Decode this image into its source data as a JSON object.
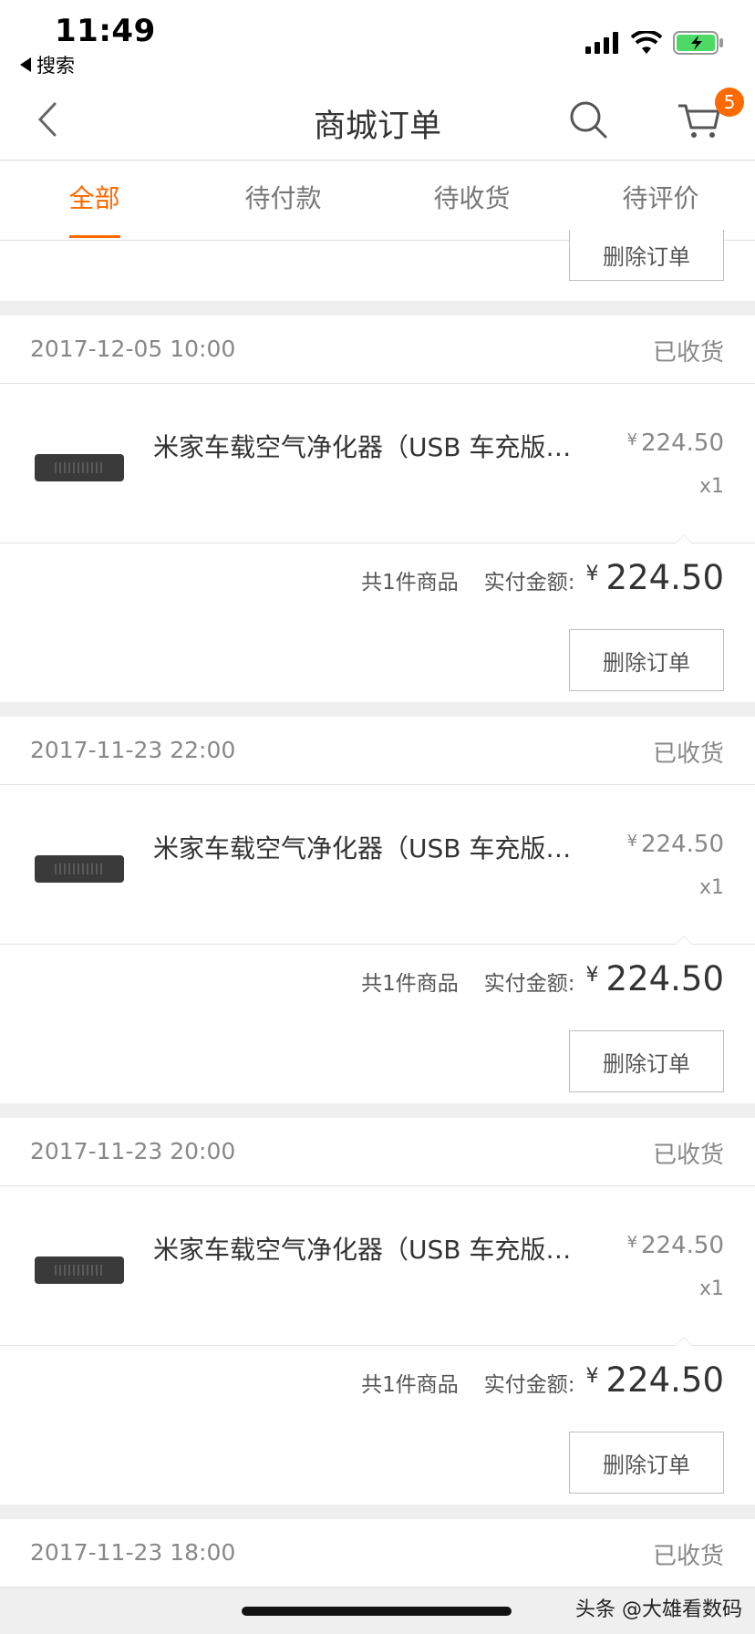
{
  "status_bar": {
    "time": "11:49",
    "back_label": "搜索"
  },
  "nav": {
    "title": "商城订单",
    "cart_badge": "5"
  },
  "tabs": [
    {
      "label": "全部",
      "active": true
    },
    {
      "label": "待付款",
      "active": false
    },
    {
      "label": "待收货",
      "active": false
    },
    {
      "label": "待评价",
      "active": false
    }
  ],
  "top_fragment": {
    "delete_label": "删除订单"
  },
  "orders": [
    {
      "date": "2017-12-05 10:00",
      "status": "已收货",
      "item_name": "米家车载空气净化器（USB 车充版…",
      "price": "224.50",
      "qty": "x1",
      "count_label": "共1件商品",
      "paid_label": "实付金额:",
      "total": "224.50",
      "delete_label": "删除订单"
    },
    {
      "date": "2017-11-23 22:00",
      "status": "已收货",
      "item_name": "米家车载空气净化器（USB 车充版…",
      "price": "224.50",
      "qty": "x1",
      "count_label": "共1件商品",
      "paid_label": "实付金额:",
      "total": "224.50",
      "delete_label": "删除订单"
    },
    {
      "date": "2017-11-23 20:00",
      "status": "已收货",
      "item_name": "米家车载空气净化器（USB 车充版…",
      "price": "224.50",
      "qty": "x1",
      "count_label": "共1件商品",
      "paid_label": "实付金额:",
      "total": "224.50",
      "delete_label": "删除订单"
    }
  ],
  "last_order": {
    "date": "2017-11-23 18:00",
    "status": "已收货"
  },
  "currency_symbol": "¥",
  "watermark": "头条 @大雄看数码",
  "colors": {
    "accent": "#ff6700",
    "badge": "#ff6a00",
    "battery": "#4cd964"
  },
  "icons": [
    "signal-icon",
    "wifi-icon",
    "battery-charging-icon",
    "back-chevron-icon",
    "search-icon",
    "cart-icon"
  ]
}
